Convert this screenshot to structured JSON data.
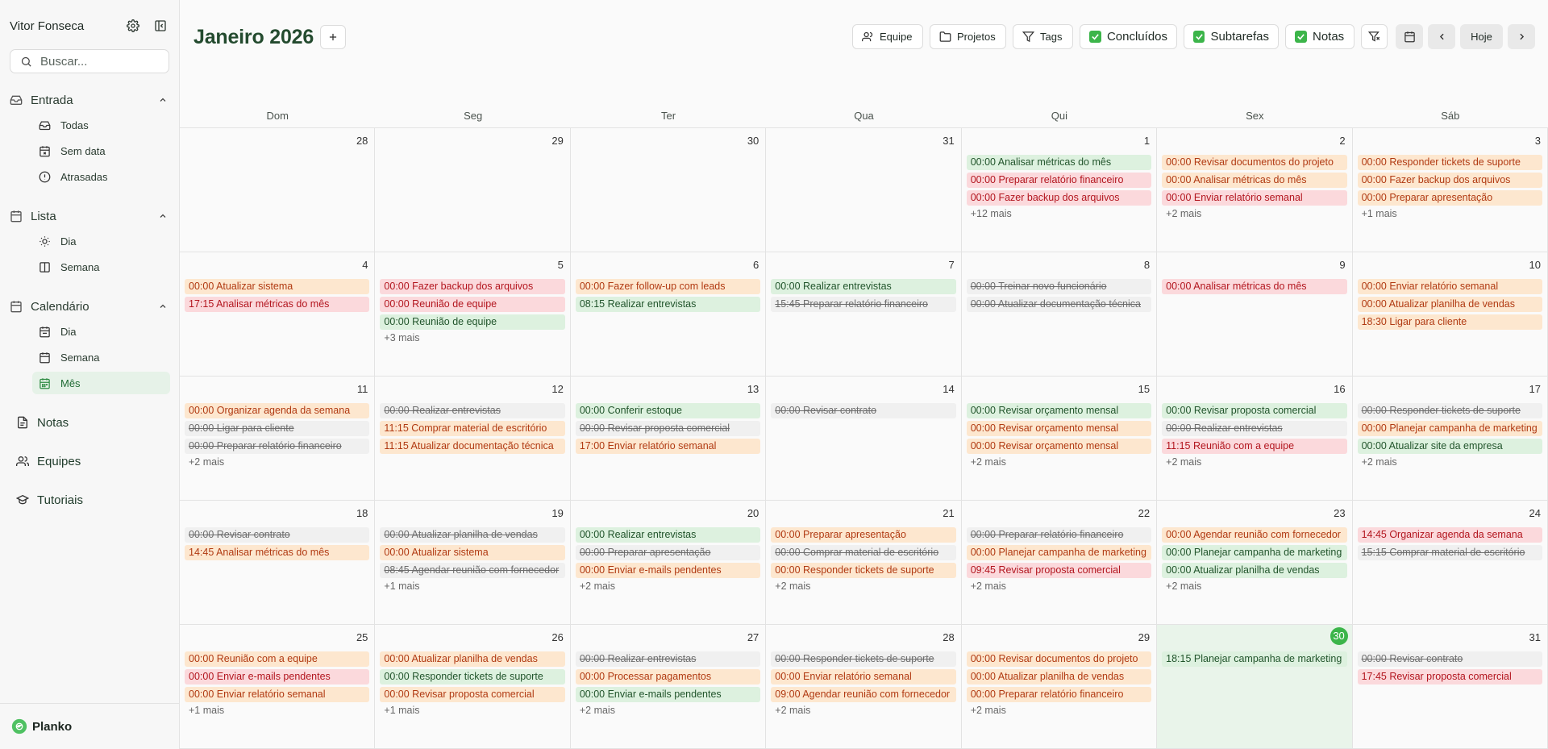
{
  "sidebar": {
    "user_name": "Vitor Fonseca",
    "search_placeholder": "Buscar...",
    "sections": {
      "inbox": {
        "label": "Entrada",
        "items": [
          "Todas",
          "Sem data",
          "Atrasadas"
        ]
      },
      "list": {
        "label": "Lista",
        "items": [
          "Dia",
          "Semana"
        ]
      },
      "calendar": {
        "label": "Calendário",
        "items": [
          "Dia",
          "Semana",
          "Mês"
        ]
      }
    },
    "notes": "Notas",
    "teams": "Equipes",
    "tutorials": "Tutoriais",
    "brand": "Planko"
  },
  "header": {
    "title": "Janeiro 2026",
    "team_btn": "Equipe",
    "projects_btn": "Projetos",
    "tags_btn": "Tags",
    "done_toggle": "Concluídos",
    "subtasks_toggle": "Subtarefas",
    "notes_toggle": "Notas",
    "today_btn": "Hoje"
  },
  "colors": {
    "accent": "#3cb54a",
    "green_bg": "#ddf1df",
    "orange_bg": "#fde7cf",
    "red_bg": "#fbd9dc"
  },
  "weekdays": [
    "Dom",
    "Seg",
    "Ter",
    "Qua",
    "Qui",
    "Sex",
    "Sáb"
  ],
  "days": [
    {
      "d": "28",
      "events": []
    },
    {
      "d": "29",
      "events": []
    },
    {
      "d": "30",
      "events": []
    },
    {
      "d": "31",
      "events": []
    },
    {
      "d": "1",
      "events": [
        {
          "t": "00:00 Analisar métricas do mês",
          "c": "green"
        },
        {
          "t": "00:00 Preparar relatório financeiro",
          "c": "red"
        },
        {
          "t": "00:00 Fazer backup dos arquivos",
          "c": "red"
        }
      ],
      "more": "+12 mais"
    },
    {
      "d": "2",
      "events": [
        {
          "t": "00:00 Revisar documentos do projeto",
          "c": "orange"
        },
        {
          "t": "00:00 Analisar métricas do mês",
          "c": "orange"
        },
        {
          "t": "00:00 Enviar relatório semanal",
          "c": "red"
        }
      ],
      "more": "+2 mais"
    },
    {
      "d": "3",
      "events": [
        {
          "t": "00:00 Responder tickets de suporte",
          "c": "orange"
        },
        {
          "t": "00:00 Fazer backup dos arquivos",
          "c": "orange"
        },
        {
          "t": "00:00 Preparar apresentação",
          "c": "orange"
        }
      ],
      "more": "+1 mais"
    },
    {
      "d": "4",
      "events": [
        {
          "t": "00:00 Atualizar sistema",
          "c": "orange"
        },
        {
          "t": "17:15 Analisar métricas do mês",
          "c": "red"
        }
      ]
    },
    {
      "d": "5",
      "events": [
        {
          "t": "00:00 Fazer backup dos arquivos",
          "c": "red"
        },
        {
          "t": "00:00 Reunião de equipe",
          "c": "red"
        },
        {
          "t": "00:00 Reunião de equipe",
          "c": "green"
        }
      ],
      "more": "+3 mais"
    },
    {
      "d": "6",
      "events": [
        {
          "t": "00:00 Fazer follow-up com leads",
          "c": "orange"
        },
        {
          "t": "08:15 Realizar entrevistas",
          "c": "green"
        }
      ]
    },
    {
      "d": "7",
      "events": [
        {
          "t": "00:00 Realizar entrevistas",
          "c": "green"
        },
        {
          "t": "15:45 Preparar relatório financeiro",
          "c": "done"
        }
      ]
    },
    {
      "d": "8",
      "events": [
        {
          "t": "00:00 Treinar novo funcionário",
          "c": "done"
        },
        {
          "t": "00:00 Atualizar documentação técnica",
          "c": "done"
        }
      ]
    },
    {
      "d": "9",
      "events": [
        {
          "t": "00:00 Analisar métricas do mês",
          "c": "red"
        }
      ]
    },
    {
      "d": "10",
      "events": [
        {
          "t": "00:00 Enviar relatório semanal",
          "c": "orange"
        },
        {
          "t": "00:00 Atualizar planilha de vendas",
          "c": "orange"
        },
        {
          "t": "18:30 Ligar para cliente",
          "c": "orange"
        }
      ]
    },
    {
      "d": "11",
      "events": [
        {
          "t": "00:00 Organizar agenda da semana",
          "c": "orange"
        },
        {
          "t": "00:00 Ligar para cliente",
          "c": "done"
        },
        {
          "t": "00:00 Preparar relatório financeiro",
          "c": "done"
        }
      ],
      "more": "+2 mais"
    },
    {
      "d": "12",
      "events": [
        {
          "t": "00:00 Realizar entrevistas",
          "c": "done"
        },
        {
          "t": "11:15 Comprar material de escritório",
          "c": "orange"
        },
        {
          "t": "11:15 Atualizar documentação técnica",
          "c": "orange"
        }
      ]
    },
    {
      "d": "13",
      "events": [
        {
          "t": "00:00 Conferir estoque",
          "c": "green"
        },
        {
          "t": "00:00 Revisar proposta comercial",
          "c": "done"
        },
        {
          "t": "17:00 Enviar relatório semanal",
          "c": "orange"
        }
      ]
    },
    {
      "d": "14",
      "events": [
        {
          "t": "00:00 Revisar contrato",
          "c": "done"
        }
      ]
    },
    {
      "d": "15",
      "events": [
        {
          "t": "00:00 Revisar orçamento mensal",
          "c": "green"
        },
        {
          "t": "00:00 Revisar orçamento mensal",
          "c": "orange"
        },
        {
          "t": "00:00 Revisar orçamento mensal",
          "c": "orange"
        }
      ],
      "more": "+2 mais"
    },
    {
      "d": "16",
      "events": [
        {
          "t": "00:00 Revisar proposta comercial",
          "c": "green"
        },
        {
          "t": "00:00 Realizar entrevistas",
          "c": "done"
        },
        {
          "t": "11:15 Reunião com a equipe",
          "c": "red"
        }
      ],
      "more": "+2 mais"
    },
    {
      "d": "17",
      "events": [
        {
          "t": "00:00 Responder tickets de suporte",
          "c": "done"
        },
        {
          "t": "00:00 Planejar campanha de marketing",
          "c": "orange"
        },
        {
          "t": "00:00 Atualizar site da empresa",
          "c": "green"
        }
      ],
      "more": "+2 mais"
    },
    {
      "d": "18",
      "events": [
        {
          "t": "00:00 Revisar contrato",
          "c": "done"
        },
        {
          "t": "14:45 Analisar métricas do mês",
          "c": "orange"
        }
      ]
    },
    {
      "d": "19",
      "events": [
        {
          "t": "00:00 Atualizar planilha de vendas",
          "c": "done"
        },
        {
          "t": "00:00 Atualizar sistema",
          "c": "orange"
        },
        {
          "t": "08:45 Agendar reunião com fornecedor",
          "c": "done"
        }
      ],
      "more": "+1 mais"
    },
    {
      "d": "20",
      "events": [
        {
          "t": "00:00 Realizar entrevistas",
          "c": "green"
        },
        {
          "t": "00:00 Preparar apresentação",
          "c": "done"
        },
        {
          "t": "00:00 Enviar e-mails pendentes",
          "c": "orange"
        }
      ],
      "more": "+2 mais"
    },
    {
      "d": "21",
      "events": [
        {
          "t": "00:00 Preparar apresentação",
          "c": "orange"
        },
        {
          "t": "00:00 Comprar material de escritório",
          "c": "done"
        },
        {
          "t": "00:00 Responder tickets de suporte",
          "c": "orange"
        }
      ],
      "more": "+2 mais"
    },
    {
      "d": "22",
      "events": [
        {
          "t": "00:00 Preparar relatório financeiro",
          "c": "done"
        },
        {
          "t": "00:00 Planejar campanha de marketing",
          "c": "orange"
        },
        {
          "t": "09:45 Revisar proposta comercial",
          "c": "red"
        }
      ],
      "more": "+2 mais"
    },
    {
      "d": "23",
      "events": [
        {
          "t": "00:00 Agendar reunião com fornecedor",
          "c": "orange"
        },
        {
          "t": "00:00 Planejar campanha de marketing",
          "c": "green"
        },
        {
          "t": "00:00 Atualizar planilha de vendas",
          "c": "green"
        }
      ],
      "more": "+2 mais"
    },
    {
      "d": "24",
      "events": [
        {
          "t": "14:45 Organizar agenda da semana",
          "c": "red"
        },
        {
          "t": "15:15 Comprar material de escritório",
          "c": "done"
        }
      ]
    },
    {
      "d": "25",
      "events": [
        {
          "t": "00:00 Reunião com a equipe",
          "c": "orange"
        },
        {
          "t": "00:00 Enviar e-mails pendentes",
          "c": "red"
        },
        {
          "t": "00:00 Enviar relatório semanal",
          "c": "orange"
        }
      ],
      "more": "+1 mais"
    },
    {
      "d": "26",
      "events": [
        {
          "t": "00:00 Atualizar planilha de vendas",
          "c": "orange"
        },
        {
          "t": "00:00 Responder tickets de suporte",
          "c": "green"
        },
        {
          "t": "00:00 Revisar proposta comercial",
          "c": "orange"
        }
      ],
      "more": "+1 mais"
    },
    {
      "d": "27",
      "events": [
        {
          "t": "00:00 Realizar entrevistas",
          "c": "done"
        },
        {
          "t": "00:00 Processar pagamentos",
          "c": "orange"
        },
        {
          "t": "00:00 Enviar e-mails pendentes",
          "c": "green"
        }
      ],
      "more": "+2 mais"
    },
    {
      "d": "28",
      "events": [
        {
          "t": "00:00 Responder tickets de suporte",
          "c": "done"
        },
        {
          "t": "00:00 Enviar relatório semanal",
          "c": "orange"
        },
        {
          "t": "09:00 Agendar reunião com fornecedor",
          "c": "orange"
        }
      ],
      "more": "+2 mais"
    },
    {
      "d": "29",
      "events": [
        {
          "t": "00:00 Revisar documentos do projeto",
          "c": "orange"
        },
        {
          "t": "00:00 Atualizar planilha de vendas",
          "c": "orange"
        },
        {
          "t": "00:00 Preparar relatório financeiro",
          "c": "orange"
        }
      ],
      "more": "+2 mais"
    },
    {
      "d": "30",
      "today": true,
      "events": [
        {
          "t": "18:15 Planejar campanha de marketing",
          "c": "green"
        }
      ]
    },
    {
      "d": "31",
      "events": [
        {
          "t": "00:00 Revisar contrato",
          "c": "done"
        },
        {
          "t": "17:45 Revisar proposta comercial",
          "c": "red"
        }
      ]
    }
  ]
}
